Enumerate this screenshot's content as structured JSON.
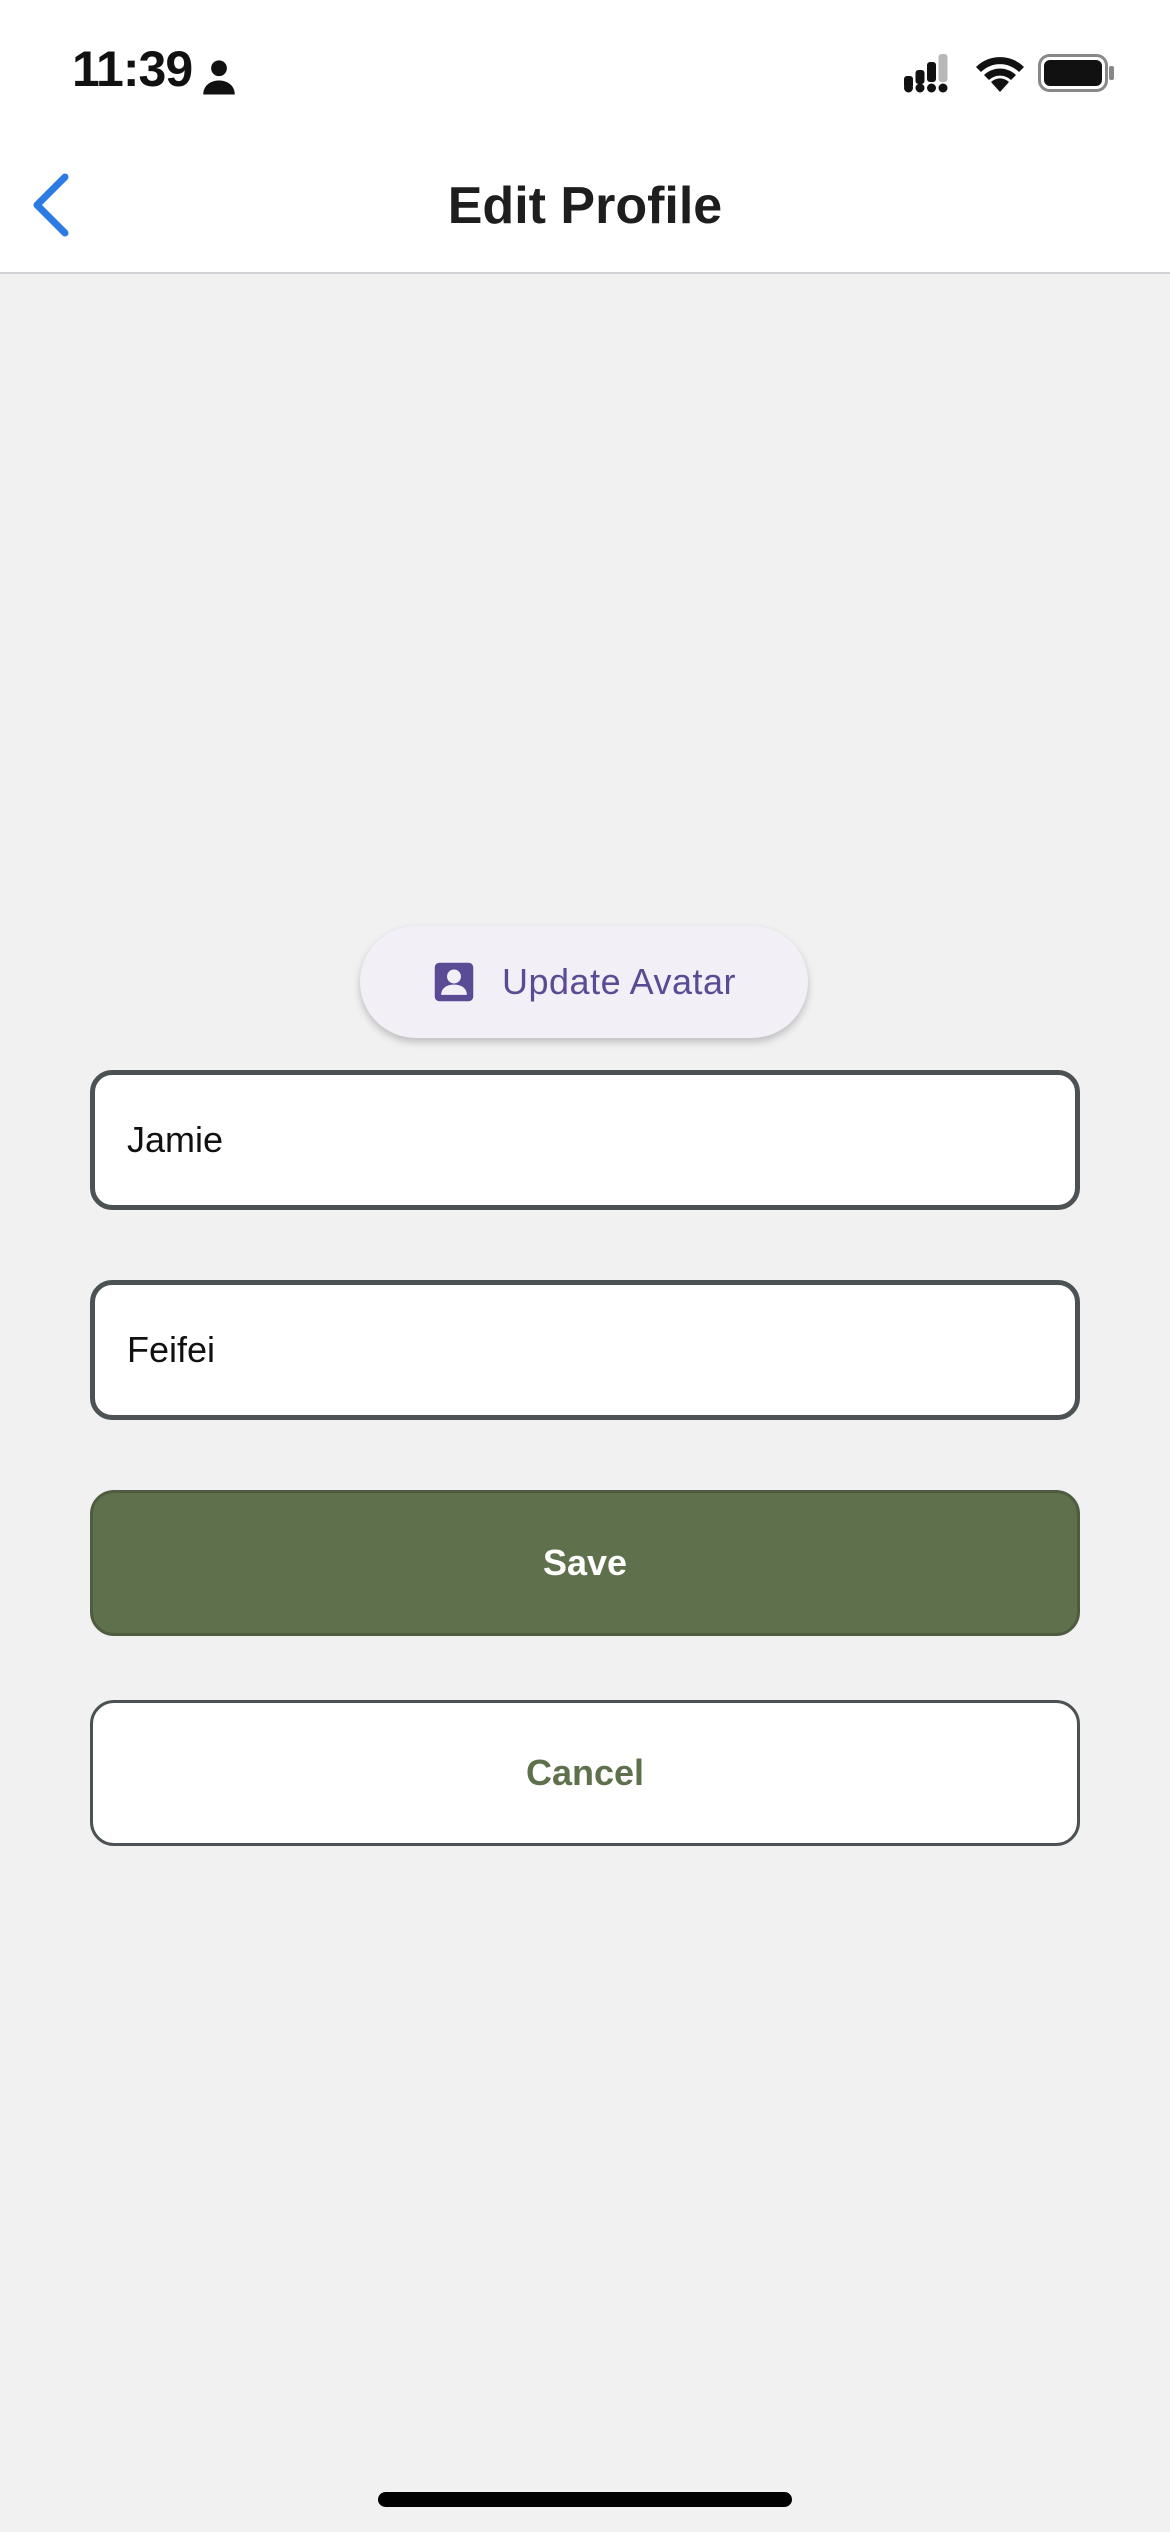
{
  "status_bar": {
    "time": "11:39",
    "icons": [
      "person-icon",
      "cellular-signal-icon",
      "wifi-icon",
      "battery-icon"
    ]
  },
  "nav": {
    "title": "Edit Profile",
    "back_icon": "chevron-left-icon"
  },
  "avatar_button": {
    "label": "Update Avatar",
    "icon": "contact-card-icon"
  },
  "form": {
    "first_name": "Jamie",
    "last_name": "Feifei"
  },
  "actions": {
    "save_label": "Save",
    "cancel_label": "Cancel"
  },
  "colors": {
    "primary": "#5f704c",
    "accent": "#5b4a94",
    "back_blue": "#2c7be5",
    "background": "#f1f1f2"
  }
}
